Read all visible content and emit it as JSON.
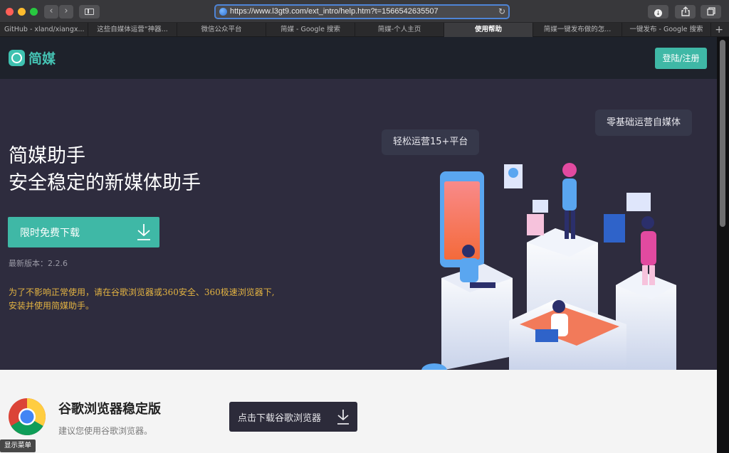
{
  "browser": {
    "url": "https://www.l3gt9.com/ext_intro/help.htm?t=1566542635507",
    "back_icon": "‹",
    "forward_icon": "›",
    "reload_icon": "↻",
    "tabs": [
      {
        "label": "GitHub - xland/xiangx...",
        "active": false
      },
      {
        "label": "这些自媒体运营“神器...",
        "active": false
      },
      {
        "label": "微信公众平台",
        "active": false
      },
      {
        "label": "简媒 - Google 搜索",
        "active": false
      },
      {
        "label": "简媒-个人主页",
        "active": false
      },
      {
        "label": "使用帮助",
        "active": true
      },
      {
        "label": "简媒一键发布做的怎...",
        "active": false
      },
      {
        "label": "一键发布 - Google 搜索",
        "active": false
      }
    ],
    "new_tab": "+"
  },
  "header": {
    "logo_text": "简媒",
    "login_label": "登陆/注册",
    "accent_color": "#3fb8a6"
  },
  "hero": {
    "title_line1": "简媒助手",
    "title_line2": "安全稳定的新媒体助手",
    "download_label": "限时免费下载",
    "version": "最新版本：2.2.6",
    "notice_line1": "为了不影响正常使用，请在谷歌浏览器或360安全、360极速浏览器下,",
    "notice_line2": "安装并使用简媒助手。",
    "bubble1": "轻松运营15+平台",
    "bubble2": "零基础运营自媒体"
  },
  "chrome_section": {
    "title": "谷歌浏览器稳定版",
    "subtitle": "建议您使用谷歌浏览器。",
    "download_label": "点击下载谷歌浏览器"
  },
  "menu_tag": "显示菜单"
}
